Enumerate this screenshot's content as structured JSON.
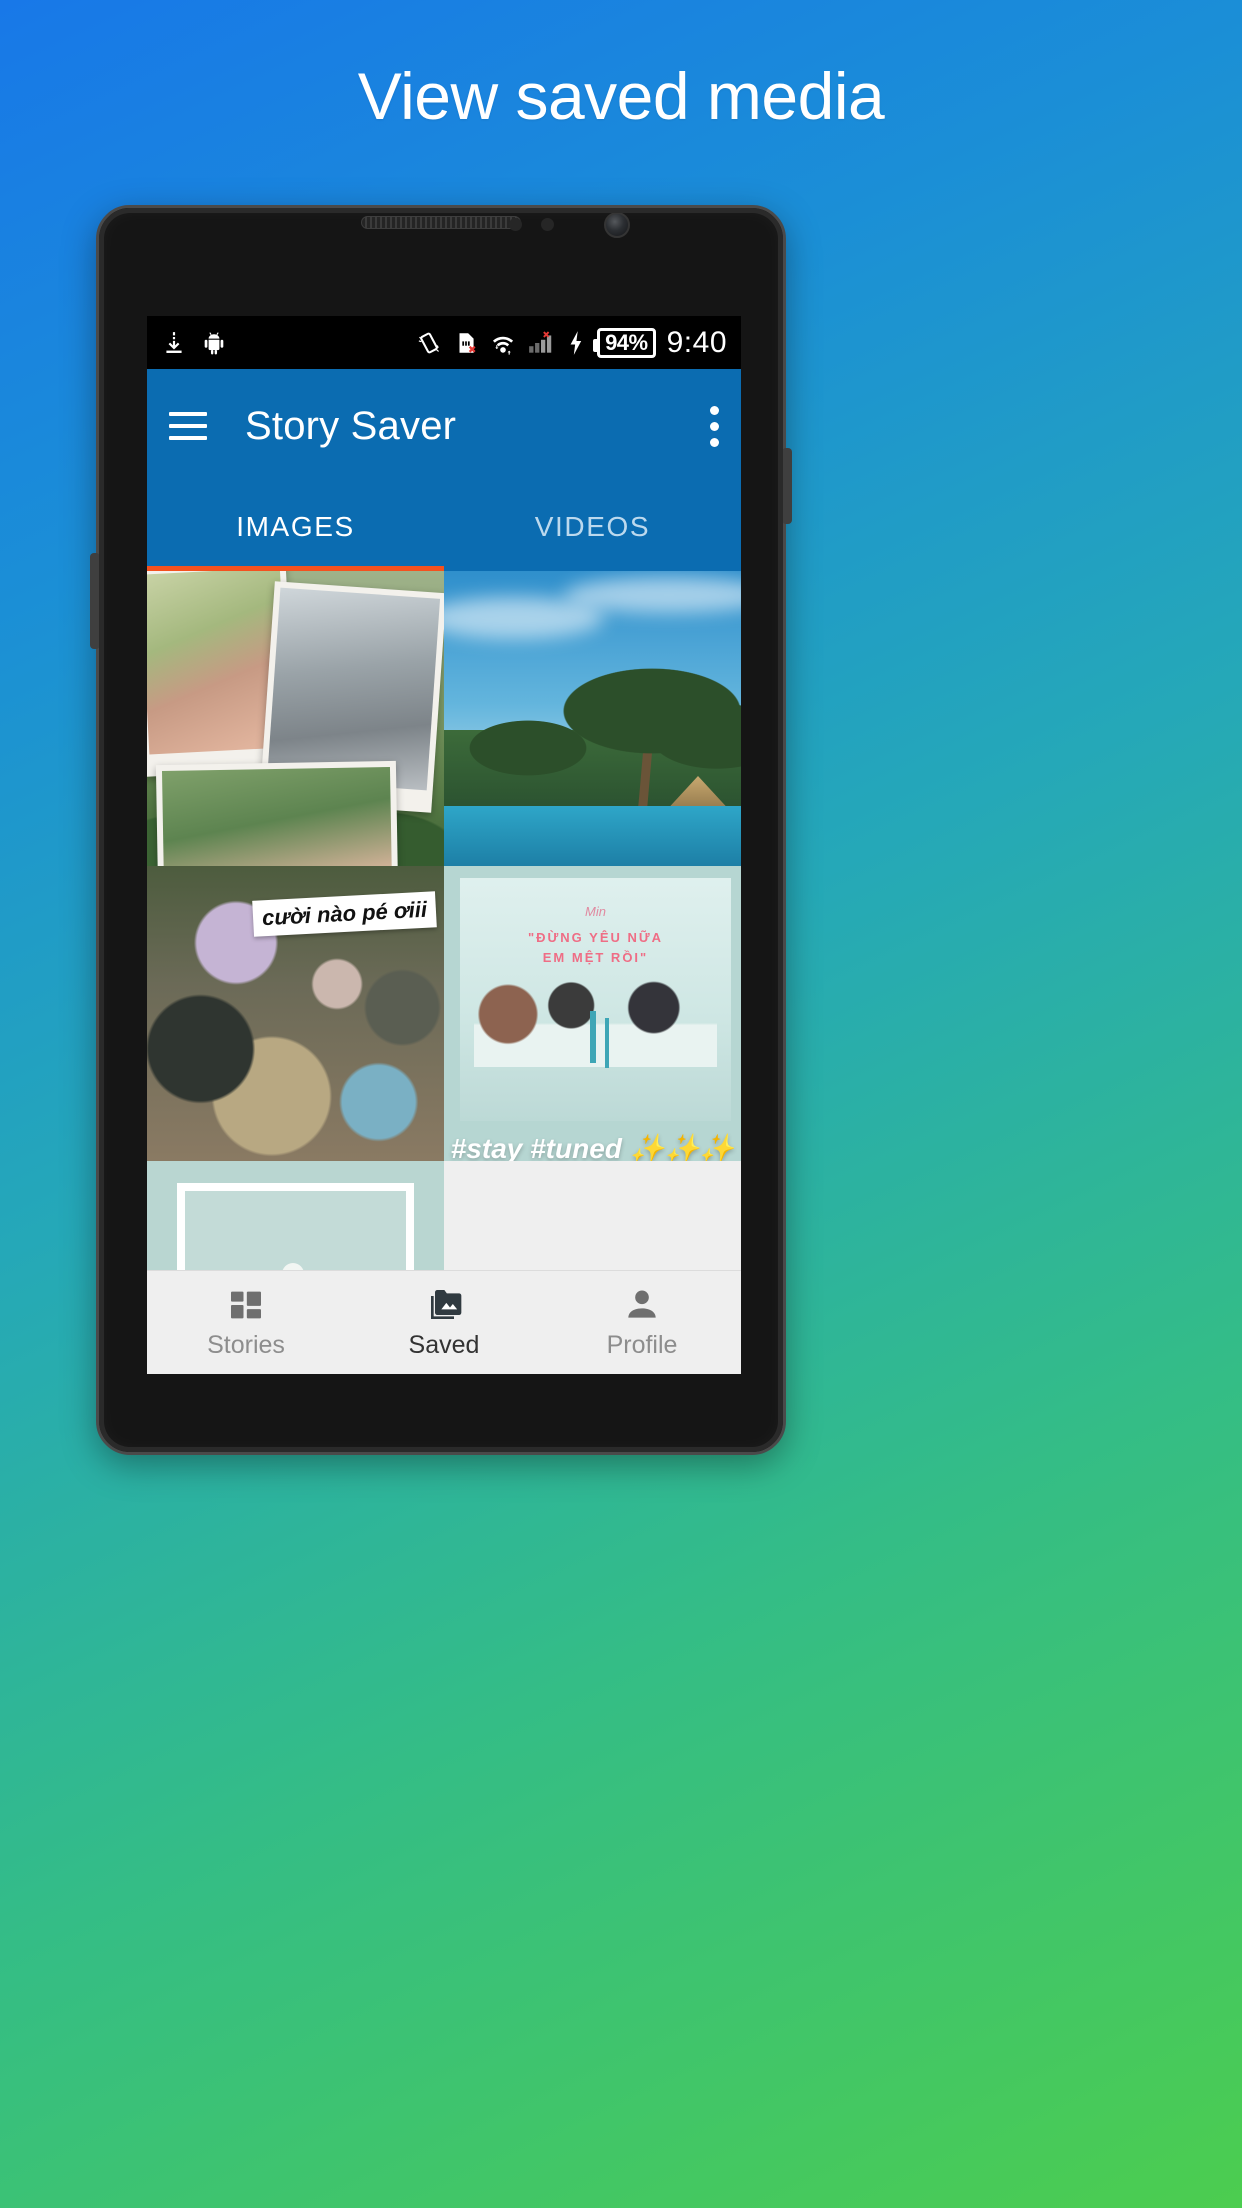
{
  "promo": {
    "headline": "View saved media"
  },
  "statusbar": {
    "icons_left": [
      "download-icon",
      "android-icon"
    ],
    "icons_right": [
      "rotate-lock-icon",
      "sdcard-error-icon",
      "wifi-off-icon",
      "signal-icon"
    ],
    "battery": {
      "level": "94%",
      "charging_icon": "lightning-bolt-icon"
    },
    "clock": "9:40"
  },
  "appbar": {
    "menu_icon": "hamburger-menu-icon",
    "title": "Story Saver",
    "overflow_icon": "more-vertical-icon"
  },
  "tabs": [
    {
      "label": "IMAGES",
      "active": true
    },
    {
      "label": "VIDEOS",
      "active": false
    }
  ],
  "accent": {
    "appbar": "#0b6cb1",
    "tab_indicator": "#f4511e",
    "status_bg": "#000000"
  },
  "gallery": {
    "tiles": [
      {
        "name": "polaroid-collage-thumbnail",
        "caption": ""
      },
      {
        "name": "palm-trees-pool-thumbnail",
        "caption": ""
      },
      {
        "name": "group-photo-thumbnail",
        "caption": "cười nào pé ơiii"
      },
      {
        "name": "mint-poster-thumbnail",
        "overlay_text": "#stay #tuned ✨✨✨",
        "poster_script": "Min",
        "poster_line1": "\"ĐỪNG YÊU NỮA",
        "poster_line2": "EM MỆT RỒI\""
      },
      {
        "name": "flowers-frame-thumbnail",
        "caption": ""
      },
      {
        "name": "empty-tile",
        "caption": ""
      }
    ]
  },
  "bottomnav": [
    {
      "label": "Stories",
      "icon": "grid-icon",
      "active": false
    },
    {
      "label": "Saved",
      "icon": "photo-library-icon",
      "active": true
    },
    {
      "label": "Profile",
      "icon": "person-icon",
      "active": false
    }
  ]
}
